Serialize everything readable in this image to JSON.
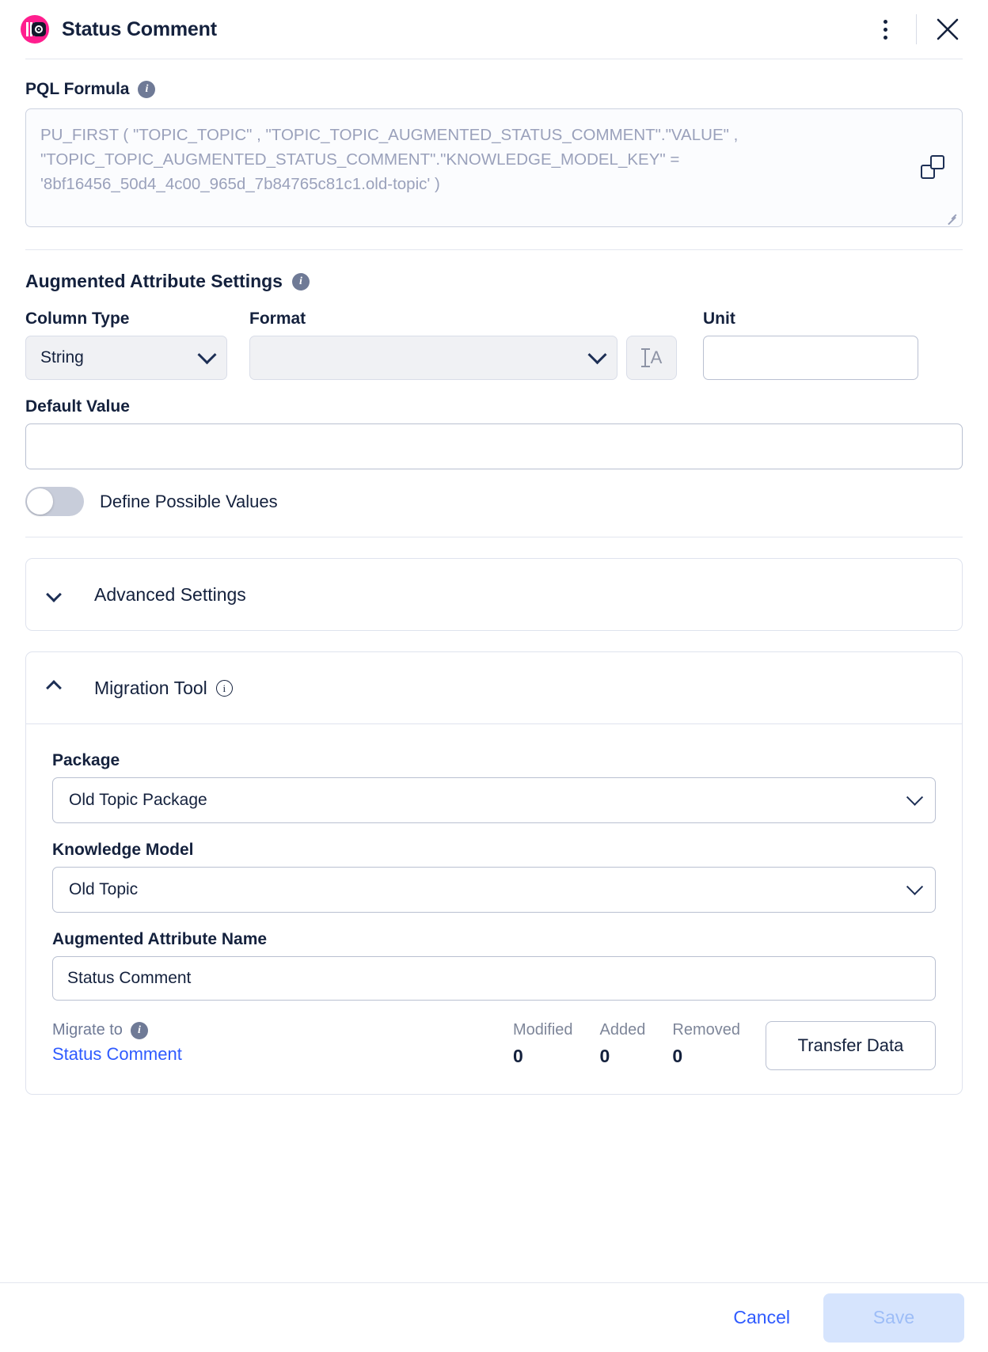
{
  "header": {
    "title": "Status Comment",
    "app_icon": "columns-chip-icon",
    "menu_icon": "kebab-menu-icon",
    "close_icon": "close-icon"
  },
  "pql": {
    "label": "PQL Formula",
    "info_icon": "info-icon",
    "formula": "PU_FIRST ( \"TOPIC_TOPIC\" , \"TOPIC_TOPIC_AUGMENTED_STATUS_COMMENT\".\"VALUE\" , \"TOPIC_TOPIC_AUGMENTED_STATUS_COMMENT\".\"KNOWLEDGE_MODEL_KEY\" = '8bf16456_50d4_4c00_965d_7b84765c81c1.old-topic' )",
    "copy_icon": "copy-icon",
    "resize_icon": "resize-grip-icon"
  },
  "augmented": {
    "section_title": "Augmented Attribute Settings",
    "info_icon": "info-icon",
    "column_type": {
      "label": "Column Type",
      "value": "String",
      "chevron_icon": "chevron-down-icon"
    },
    "format": {
      "label": "Format",
      "value": "",
      "placeholder": "",
      "chevron_icon": "chevron-down-icon"
    },
    "format_button": {
      "icon": "text-format-icon",
      "glyph": "A"
    },
    "unit": {
      "label": "Unit",
      "value": "",
      "placeholder": ""
    },
    "default_value": {
      "label": "Default Value",
      "value": "",
      "placeholder": ""
    },
    "define_possible_values": {
      "label": "Define Possible Values",
      "checked": false
    }
  },
  "advanced": {
    "title": "Advanced Settings",
    "expanded": false,
    "chevron_icon": "chevron-down-icon"
  },
  "migration": {
    "title": "Migration Tool",
    "expanded": true,
    "chevron_icon": "chevron-up-icon",
    "info_icon": "info-outline-icon",
    "package": {
      "label": "Package",
      "value": "Old Topic Package",
      "chevron_icon": "chevron-down-icon"
    },
    "knowledge_model": {
      "label": "Knowledge Model",
      "value": "Old Topic",
      "chevron_icon": "chevron-down-icon"
    },
    "attribute_name": {
      "label": "Augmented Attribute Name",
      "value": "Status Comment",
      "placeholder": ""
    },
    "migrate_to": {
      "caption": "Migrate to",
      "info_icon": "info-icon",
      "target": "Status Comment"
    },
    "stats": [
      {
        "key": "Modified",
        "value": "0"
      },
      {
        "key": "Added",
        "value": "0"
      },
      {
        "key": "Removed",
        "value": "0"
      }
    ],
    "transfer_button": "Transfer Data"
  },
  "footer": {
    "cancel": "Cancel",
    "save": "Save",
    "save_disabled": true
  },
  "colors": {
    "brand_pink": "#ff1e8e",
    "accent_blue": "#2f5bff",
    "text_dark": "#14213d",
    "muted": "#6f7a96",
    "placeholder": "#9aa1bb",
    "border": "#b9c0d1",
    "card_border": "#dfe3ee",
    "save_disabled_bg": "#d6e4fd",
    "save_disabled_fg": "#9dbdf7"
  }
}
